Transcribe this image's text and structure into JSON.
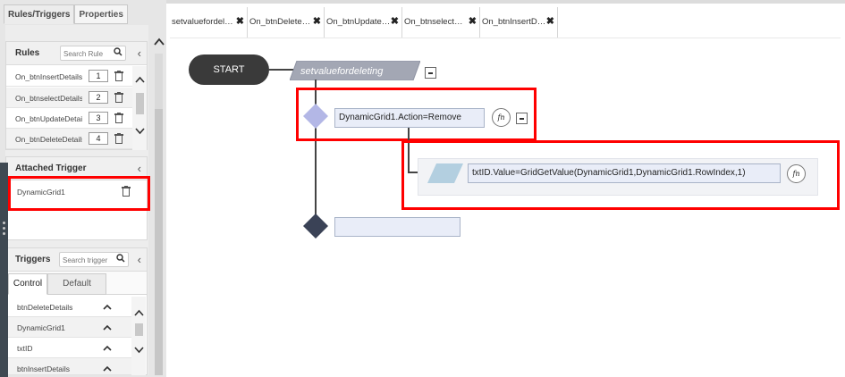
{
  "left_panel": {
    "tabs": [
      {
        "label": "Rules/Triggers"
      },
      {
        "label": "Properties"
      }
    ],
    "rules": {
      "title": "Rules",
      "search_placeholder": "Search Rule",
      "items": [
        {
          "name": "On_btnInsertDetails",
          "order": "1"
        },
        {
          "name": "On_btnselectDetails",
          "order": "2"
        },
        {
          "name": "On_btnUpdateDetails",
          "order": "3"
        },
        {
          "name": "On_btnDeleteDetails",
          "order": "4"
        }
      ]
    },
    "attached_trigger": {
      "title": "Attached Trigger",
      "items": [
        {
          "name": "DynamicGrid1"
        }
      ]
    },
    "triggers": {
      "title": "Triggers",
      "search_placeholder": "Search trigger",
      "tabs": [
        {
          "label": "Control"
        },
        {
          "label": "Default"
        }
      ],
      "items": [
        {
          "name": "btnDeleteDetails"
        },
        {
          "name": "DynamicGrid1"
        },
        {
          "name": "txtID"
        },
        {
          "name": "btnInsertDetails"
        }
      ]
    }
  },
  "editor": {
    "tabs": [
      {
        "label": "setvaluefordel…"
      },
      {
        "label": "On_btnDelete…"
      },
      {
        "label": "On_btnUpdate…"
      },
      {
        "label": "On_btnselect…"
      },
      {
        "label": "On_btnInsertD…"
      }
    ],
    "flow": {
      "start_label": "START",
      "rule_name": "setvaluefordeleting",
      "condition": "DynamicGrid1.Action=Remove",
      "action": "txtID.Value=GridGetValue(DynamicGrid1,DynamicGrid1.RowIndex,1)",
      "end_value": "",
      "fn_label": "fn"
    }
  },
  "colors": {
    "highlight": "#ff0000",
    "diamond_light": "#b3b7e6",
    "diamond_dark": "#3a4256",
    "parallelogram": "#b3cfe0",
    "rule_banner": "#a3a7b4",
    "start_pill": "#3a3a3a"
  },
  "icons": {
    "search": "search-icon",
    "trash": "trash-icon",
    "close": "close-icon",
    "chevron_left": "chevron-left-icon",
    "chevron_up": "chevron-up-icon",
    "chevron_down": "chevron-down-icon",
    "function": "function-icon",
    "collapse": "minus-icon"
  }
}
